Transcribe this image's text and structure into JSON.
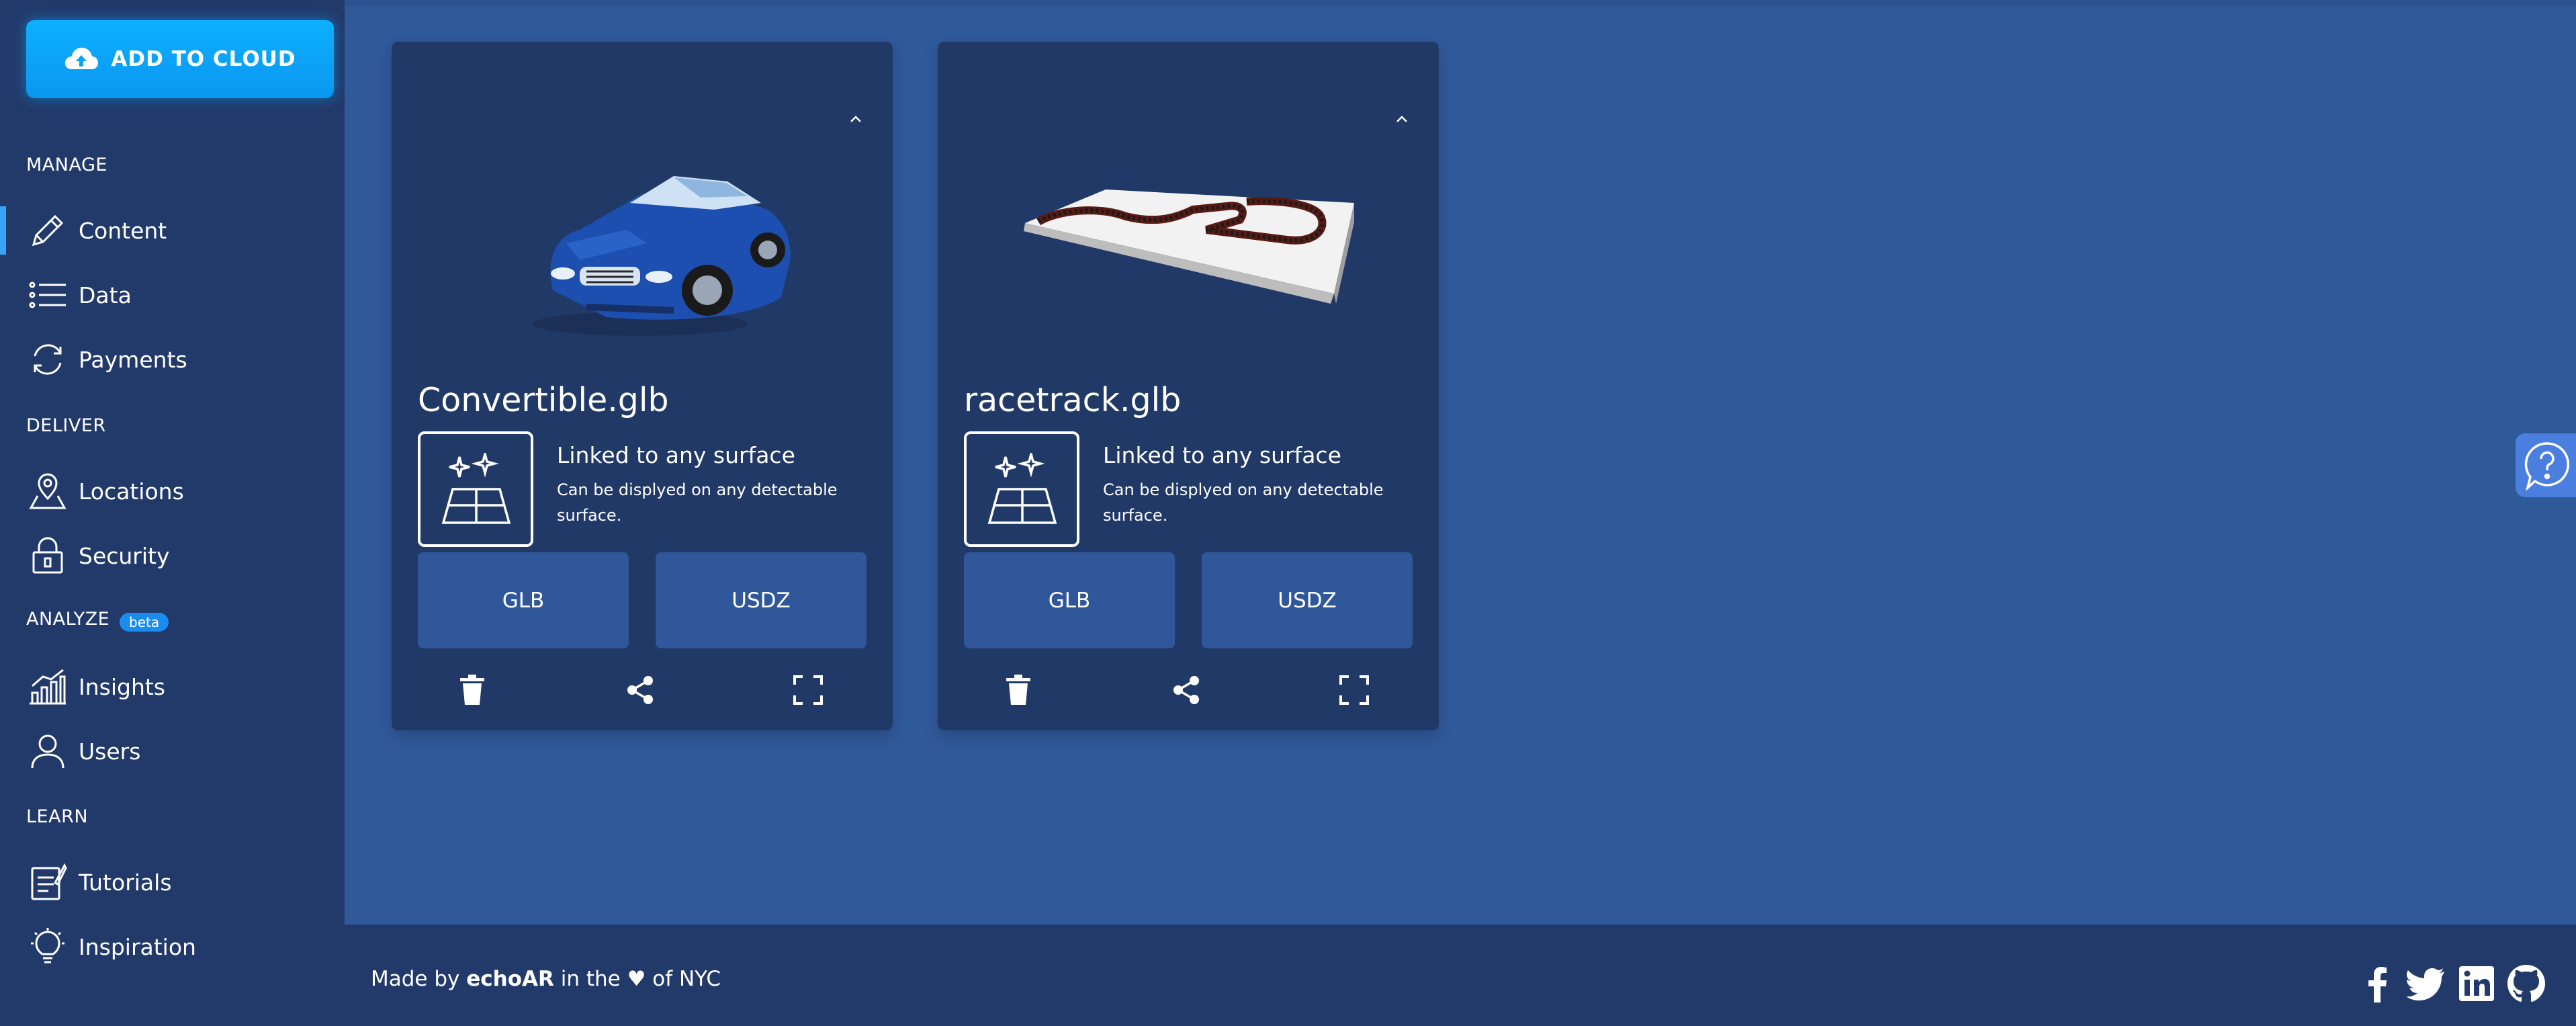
{
  "sidebar": {
    "add_to_cloud_label": "ADD TO CLOUD",
    "sections": {
      "manage": "MANAGE",
      "deliver": "DELIVER",
      "analyze": "ANALYZE",
      "analyze_badge": "beta",
      "learn": "LEARN"
    },
    "items": [
      {
        "label": "Content",
        "icon": "pencil-icon",
        "active": true
      },
      {
        "label": "Data",
        "icon": "list-icon"
      },
      {
        "label": "Payments",
        "icon": "refresh-icon"
      },
      {
        "label": "Locations",
        "icon": "map-pin-icon"
      },
      {
        "label": "Security",
        "icon": "lock-icon"
      },
      {
        "label": "Insights",
        "icon": "bar-chart-icon"
      },
      {
        "label": "Users",
        "icon": "user-icon"
      },
      {
        "label": "Tutorials",
        "icon": "notebook-icon"
      },
      {
        "label": "Inspiration",
        "icon": "lightbulb-icon"
      }
    ]
  },
  "cards": [
    {
      "filename": "Convertible.glb",
      "thumbnail": "blue convertible car model",
      "surface_title": "Linked to any surface",
      "surface_desc": "Can be displyed on any detectable surface.",
      "glb_label": "GLB",
      "usdz_label": "USDZ"
    },
    {
      "filename": "racetrack.glb",
      "thumbnail": "white racetrack model",
      "surface_title": "Linked to any surface",
      "surface_desc": "Can be displyed on any detectable surface.",
      "glb_label": "GLB",
      "usdz_label": "USDZ"
    }
  ],
  "footer": {
    "made_by": "Made by",
    "brand": "echoAR",
    "in_the": "in the",
    "heart": "♥",
    "of_city": "of NYC",
    "social": [
      "facebook-icon",
      "twitter-icon",
      "linkedin-icon",
      "github-icon"
    ]
  },
  "colors": {
    "main_bg": "#30599a",
    "sidebar_bg": "#223a6a",
    "card_bg": "#213966",
    "button_bg": "#2f5799",
    "accent": "#0db0ff",
    "help_bg": "#4a7fdf"
  }
}
